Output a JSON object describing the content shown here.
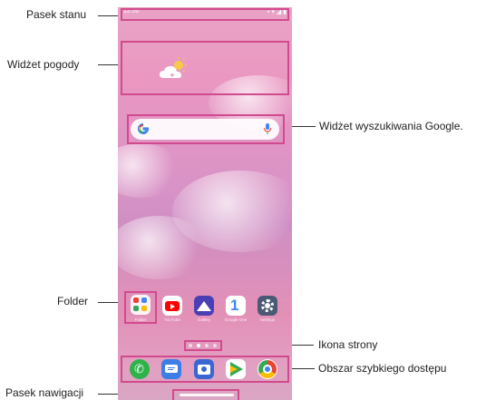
{
  "labels": {
    "status_bar": "Pasek stanu",
    "weather_widget": "Widżet pogody",
    "google_search_widget": "Widżet wyszukiwania Google.",
    "folder": "Folder",
    "page_icon": "Ikona strony",
    "quick_access_area": "Obszar szybkiego dostępu",
    "navigation_bar": "Pasek nawigacji"
  },
  "phone": {
    "status_time": "12:00",
    "status_icons": "▪ ▾ ◢ ▮",
    "apps_row": [
      {
        "label": "Folder",
        "icon": "folder-icon"
      },
      {
        "label": "YouTube",
        "icon": "youtube-icon"
      },
      {
        "label": "Gallery",
        "icon": "gallery-icon"
      },
      {
        "label": "Google One",
        "icon": "google-one-icon"
      },
      {
        "label": "Settings",
        "icon": "settings-icon"
      }
    ],
    "dock": [
      {
        "icon": "phone-icon"
      },
      {
        "icon": "messages-icon"
      },
      {
        "icon": "camera-icon"
      },
      {
        "icon": "play-store-icon"
      },
      {
        "icon": "chrome-icon"
      }
    ],
    "page_count": 4,
    "active_page": 2
  },
  "colors": {
    "highlight": "#d24a8e",
    "wallpaper_pink": "#e395c4"
  }
}
